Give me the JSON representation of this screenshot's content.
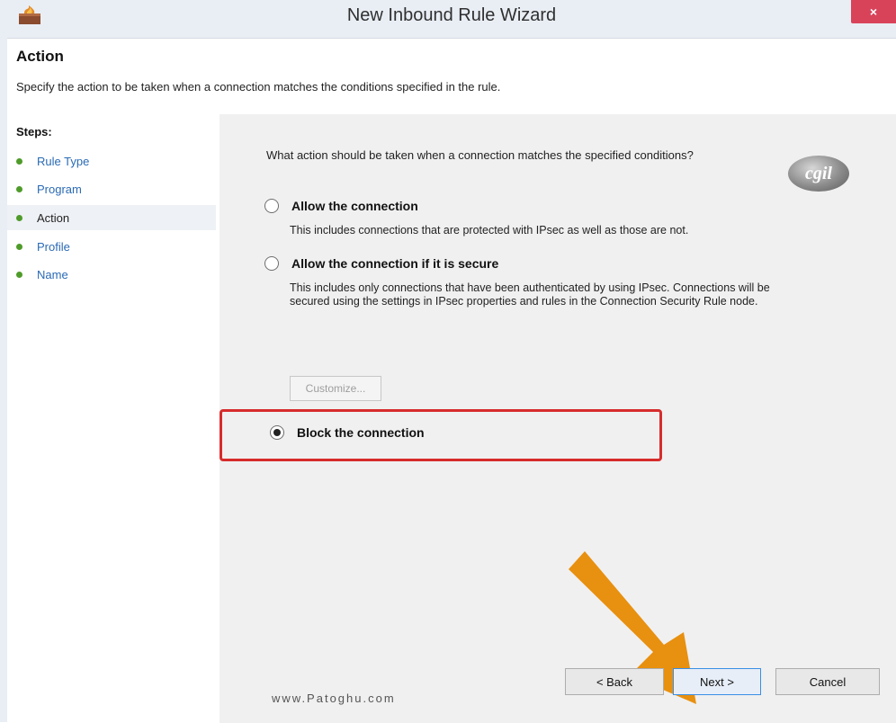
{
  "window": {
    "title": "New Inbound Rule Wizard",
    "close_glyph": "×",
    "icon": "firewall-app-icon"
  },
  "header": {
    "title": "Action",
    "description": "Specify the action to be taken when a connection matches the conditions specified in the rule."
  },
  "steps": {
    "title": "Steps:",
    "items": [
      {
        "label": "Rule Type",
        "current": false
      },
      {
        "label": "Program",
        "current": false
      },
      {
        "label": "Action",
        "current": true
      },
      {
        "label": "Profile",
        "current": false
      },
      {
        "label": "Name",
        "current": false
      }
    ]
  },
  "content": {
    "question": "What action should be taken when a connection matches the specified conditions?",
    "logo_text": "cgil",
    "options": [
      {
        "label": "Allow the connection",
        "description": "This includes connections that are protected with IPsec as well as those are not.",
        "selected": false
      },
      {
        "label": "Allow the connection if it is secure",
        "description": "This includes only connections that have been authenticated by using IPsec.  Connections will be secured using the settings in IPsec properties and rules in the Connection Security Rule node.",
        "selected": false
      },
      {
        "label": "Block the connection",
        "selected": true
      }
    ],
    "customize_label": "Customize..."
  },
  "watermark": "www.Patoghu.com",
  "buttons": {
    "back": "< Back",
    "next": "Next >",
    "cancel": "Cancel"
  },
  "colors": {
    "highlight": "#d72c2c",
    "arrow": "#e8900f",
    "close": "#d9435a",
    "step_dot": "#4f9b2a",
    "link": "#2a6ab5"
  }
}
